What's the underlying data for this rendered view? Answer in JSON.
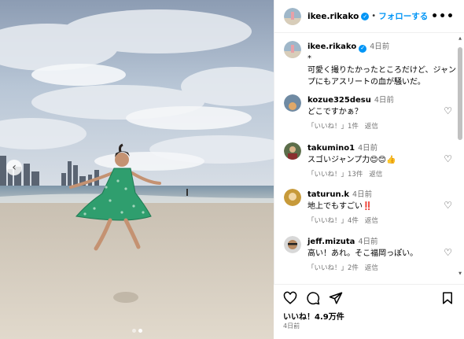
{
  "post": {
    "username": "ikee.rikako",
    "follow_label": "フォローする",
    "more_label": "•••",
    "caption_time": "4日前",
    "caption_line1": "*",
    "caption_text": "可愛く撮りたかったところだけど、ジャンプにもアスリートの血が騒いだ。"
  },
  "comments": [
    {
      "username": "kozue325desu",
      "time": "4日前",
      "text": "どこですかぁ？",
      "likes": "",
      "reply_label": "返信",
      "like_label": "「いいね！」1件"
    },
    {
      "username": "takumino1",
      "time": "4日前",
      "text": "スゴいジャンプ力😊😊👍",
      "like_label": "「いいね！」13件",
      "reply_label": "返信"
    },
    {
      "username": "taturun.k",
      "time": "4日前",
      "text": "地上でもすごい‼️",
      "like_label": "「いいね！」4件",
      "reply_label": "返信"
    },
    {
      "username": "jeff.mizuta",
      "time": "4日前",
      "text": "高い！あれ。そこ福岡っぽい。",
      "like_label": "「いいね！」2件",
      "reply_label": "返信"
    }
  ],
  "actions": {
    "likes_text": "いいね！4.9万件",
    "posted_ago": "4日前"
  },
  "icons": {
    "nav_prev": "chevron-left-icon",
    "verified": "verified-badge-icon",
    "heart": "heart-outline-icon",
    "comment": "comment-bubble-icon",
    "share": "paper-plane-icon",
    "save": "bookmark-icon"
  },
  "colors": {
    "accent": "#0095f6",
    "muted": "#737373",
    "verified": "#0095f6"
  },
  "carousel": {
    "slides": 2,
    "active": 1
  }
}
